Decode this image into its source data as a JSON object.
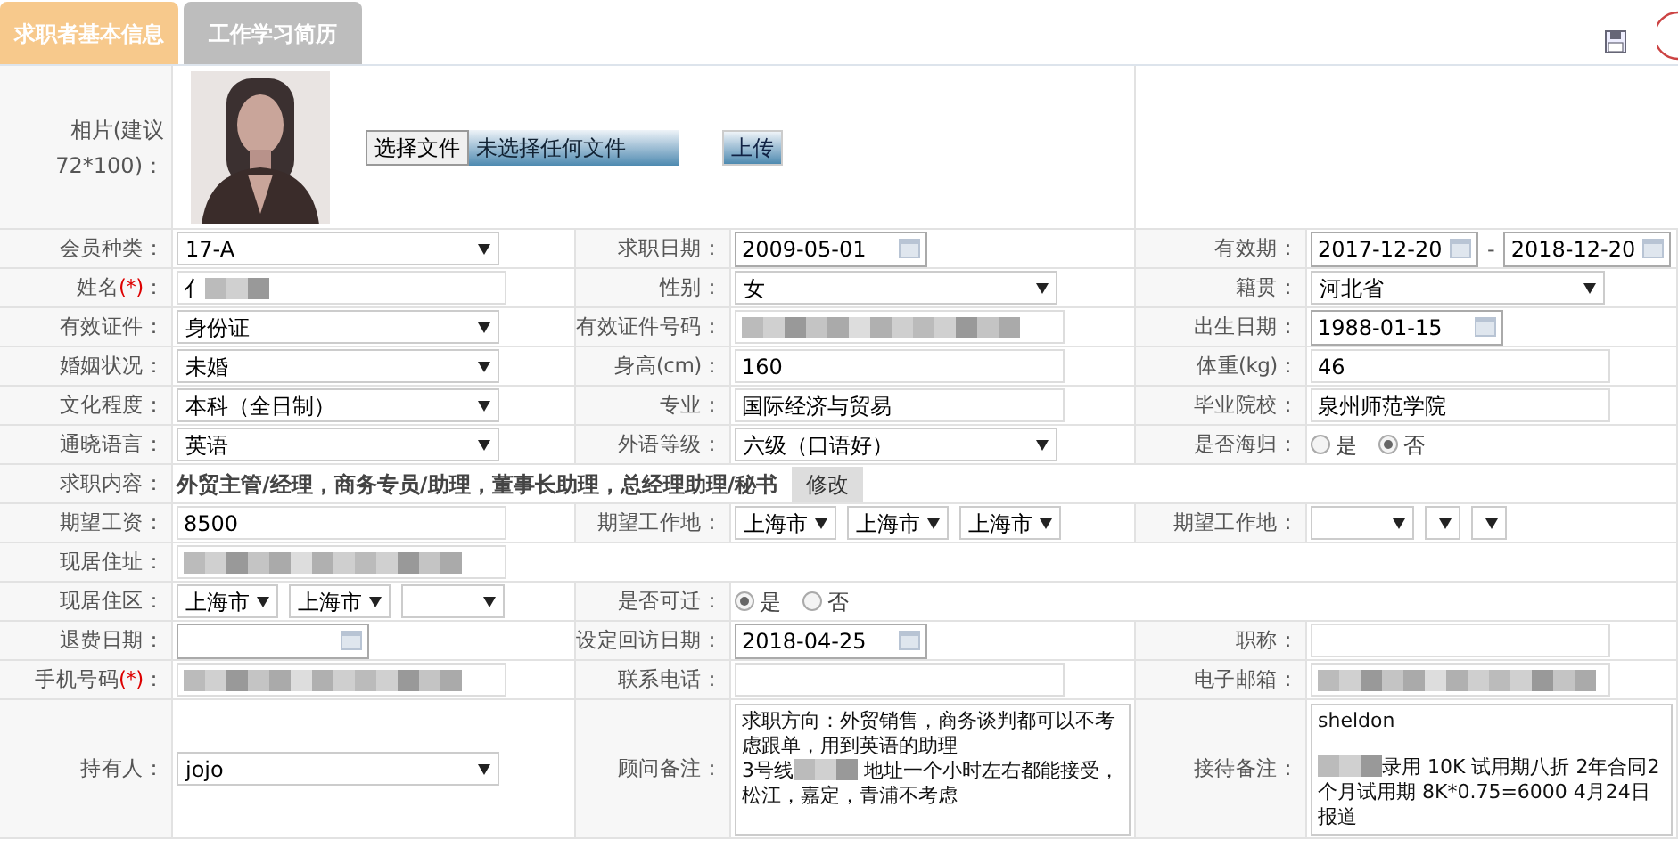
{
  "tabs": [
    {
      "label": "求职者基本信息",
      "selected": true
    },
    {
      "label": "工作学习简历",
      "selected": false
    }
  ],
  "rows": [
    {
      "fields": [
        {
          "label": "相片(建议72*100)：",
          "control": {
            "file_button": "选择文件",
            "file_status": "未选择任何文件",
            "upload_button": "上传"
          }
        }
      ]
    },
    {
      "fields": [
        {
          "label": "会员种类：",
          "control": {
            "kind": "select",
            "value": "17-A"
          }
        },
        {
          "label": "求职日期：",
          "control": {
            "kind": "date",
            "value": "2009-05-01"
          }
        },
        {
          "label": "有效期：",
          "control": {
            "kind": "date_range",
            "from": "2017-12-20",
            "separator": "-",
            "to": "2018-12-20"
          }
        }
      ]
    },
    {
      "fields": [
        {
          "label": "姓名",
          "required_mark": "(*)",
          "label_end": "：",
          "control": {
            "kind": "input",
            "value": "亻",
            "redacted": true
          }
        },
        {
          "label": "性别：",
          "control": {
            "kind": "select",
            "value": "女"
          }
        },
        {
          "label": "籍贯：",
          "control": {
            "kind": "select",
            "value": "河北省"
          }
        }
      ]
    },
    {
      "fields": [
        {
          "label": "有效证件：",
          "control": {
            "kind": "select",
            "value": "身份证"
          }
        },
        {
          "label": "有效证件号码：",
          "control": {
            "kind": "input",
            "redacted": true
          }
        },
        {
          "label": "出生日期：",
          "control": {
            "kind": "date",
            "value": "1988-01-15"
          }
        }
      ]
    },
    {
      "fields": [
        {
          "label": "婚姻状况：",
          "control": {
            "kind": "select",
            "value": "未婚"
          }
        },
        {
          "label": "身高(cm)：",
          "control": {
            "kind": "input",
            "value": "160"
          }
        },
        {
          "label": "体重(kg)：",
          "control": {
            "kind": "input",
            "value": "46"
          }
        }
      ]
    },
    {
      "fields": [
        {
          "label": "文化程度：",
          "control": {
            "kind": "select",
            "value": "本科（全日制）"
          }
        },
        {
          "label": "专业：",
          "control": {
            "kind": "input",
            "value": "国际经济与贸易"
          }
        },
        {
          "label": "毕业院校：",
          "control": {
            "kind": "input",
            "value": "泉州师范学院"
          }
        }
      ]
    },
    {
      "fields": [
        {
          "label": "通晓语言：",
          "control": {
            "kind": "select",
            "value": "英语"
          }
        },
        {
          "label": "外语等级：",
          "control": {
            "kind": "select",
            "value": "六级（口语好）"
          }
        },
        {
          "label": "是否海归：",
          "control": {
            "kind": "radio",
            "options": [
              {
                "label": "是",
                "selected": false
              },
              {
                "label": "否",
                "selected": true
              }
            ]
          }
        }
      ]
    },
    {
      "fields": [
        {
          "label": "求职内容：",
          "control": {
            "kind": "text_button",
            "text": "外贸主管/经理，商务专员/助理，董事长助理，总经理助理/秘书",
            "button": "修改"
          }
        }
      ]
    },
    {
      "fields": [
        {
          "label": "期望工资：",
          "control": {
            "kind": "input",
            "value": "8500"
          }
        },
        {
          "label": "期望工作地：",
          "control": {
            "kind": "selects",
            "items": [
              {
                "value": "上海市"
              },
              {
                "value": "上海市"
              },
              {
                "value": "上海市"
              }
            ]
          }
        },
        {
          "label": "期望工作地：",
          "control": {
            "kind": "selects",
            "items": [
              {
                "blank": true
              },
              {
                "blank": true
              },
              {
                "blank": true
              }
            ]
          }
        }
      ]
    },
    {
      "fields": [
        {
          "label": "现居住址：",
          "control": {
            "kind": "input",
            "redacted": true
          }
        }
      ]
    },
    {
      "fields": [
        {
          "label": "现居住区：",
          "control": {
            "kind": "selects",
            "items": [
              {
                "value": "上海市"
              },
              {
                "value": "上海市"
              },
              {
                "blank": true
              }
            ]
          }
        },
        {
          "label": "是否可迁：",
          "control": {
            "kind": "radio",
            "options": [
              {
                "label": "是",
                "selected": true
              },
              {
                "label": "否",
                "selected": false
              }
            ]
          }
        }
      ]
    },
    {
      "fields": [
        {
          "label": "退费日期：",
          "control": {
            "kind": "date"
          }
        },
        {
          "label": "设定回访日期：",
          "control": {
            "kind": "date",
            "value": "2018-04-25"
          }
        },
        {
          "label": "职称：",
          "control": {
            "kind": "input"
          }
        }
      ]
    },
    {
      "fields": [
        {
          "label": "手机号码",
          "required_mark": "(*)",
          "label_end": "：",
          "control": {
            "kind": "input",
            "redacted": true
          }
        },
        {
          "label": "联系电话：",
          "control": {
            "kind": "input"
          }
        },
        {
          "label": "电子邮箱：",
          "control": {
            "kind": "input",
            "redacted": true
          }
        }
      ]
    },
    {
      "fields": [
        {
          "label": "持有人：",
          "control": {
            "kind": "select",
            "value": "jojo"
          }
        },
        {
          "label": "顾问备注：",
          "control": {
            "kind": "textarea",
            "paragraphs": [
              [
                {
                  "text": "求职方向：外贸销售，商务谈判都可以不考虑跟单，用到英语的助理"
                }
              ],
              [
                {
                  "text": "3号线"
                },
                {
                  "redacted": true
                },
                {
                  "text": " 地址一个小时左右都能接受，松江，嘉定，青浦不考虑"
                }
              ]
            ]
          }
        },
        {
          "label": "接待备注：",
          "control": {
            "kind": "textarea",
            "paragraphs": [
              [
                {
                  "text": "sheldon"
                }
              ],
              [
                {
                  "gap_before": true,
                  "redacted": true
                },
                {
                  "text": "录用 10K  试用期八折 2年合同2个月试用期 8K*0.75=6000 4月24日报道"
                }
              ]
            ]
          }
        }
      ]
    }
  ]
}
